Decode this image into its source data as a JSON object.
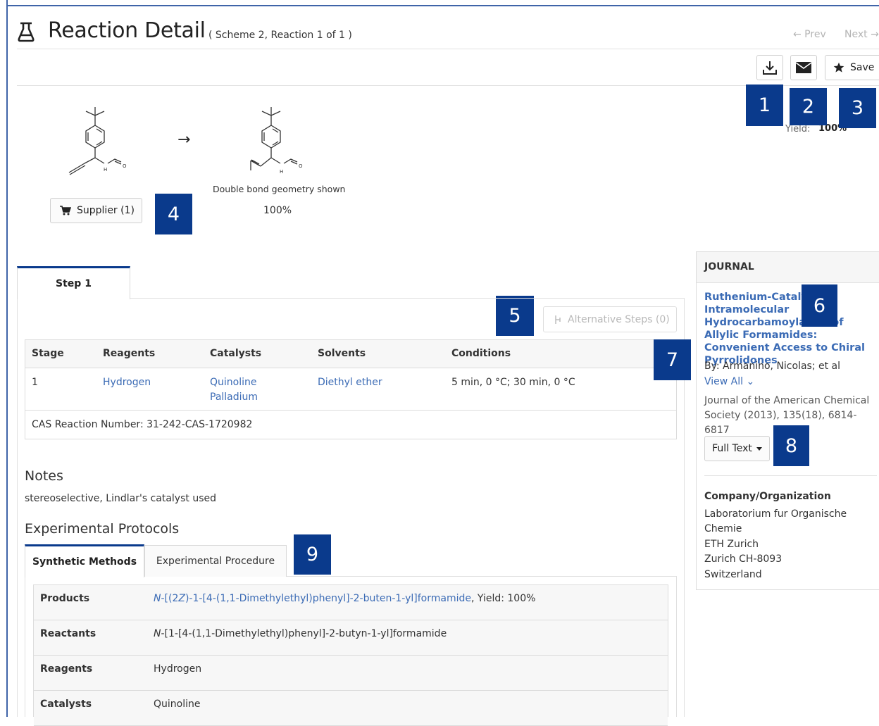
{
  "header": {
    "title": "Reaction Detail",
    "subtitle": "( Scheme 2, Reaction 1 of 1 )",
    "prev_label": "← Prev",
    "next_label": "Next →",
    "save_label": "Save"
  },
  "reaction": {
    "arrow": "→",
    "double_bond_note": "Double bond geometry shown",
    "product_yield": "100%",
    "supplier_label": "Supplier (1)",
    "yield_label": "Yield:",
    "yield_value": "100%"
  },
  "badges": [
    "1",
    "2",
    "3",
    "4",
    "5",
    "6",
    "7",
    "8",
    "9"
  ],
  "steps": {
    "tab_label": "Step 1",
    "alt_steps_label": "Alternative Steps (0)"
  },
  "reaction_table": {
    "headers": [
      "Stage",
      "Reagents",
      "Catalysts",
      "Solvents",
      "Conditions"
    ],
    "row": {
      "stage": "1",
      "reagents": "Hydrogen",
      "catalyst_1": "Quinoline",
      "catalyst_2": "Palladium",
      "solvents": "Diethyl ether",
      "conditions": "5 min, 0 °C; 30 min, 0 °C"
    },
    "cas_number": "CAS Reaction Number: 31-242-CAS-1720982"
  },
  "notes": {
    "heading": "Notes",
    "text": "stereoselective, Lindlar's catalyst used"
  },
  "protocols": {
    "heading": "Experimental Protocols",
    "tab_synthetic": "Synthetic Methods",
    "tab_procedure": "Experimental Procedure",
    "rows": [
      {
        "label": "Products",
        "prefix": "N",
        "value": "-[(2",
        "z": "Z",
        "rest": ")-1-[4-(1,1-Dimethylethyl)phenyl]-2-buten-1-yl]formamide",
        "suffix": ", Yield: 100%"
      },
      {
        "label": "Reactants",
        "prefix": "N",
        "value": "-[1-[4-(1,1-Dimethylethyl)phenyl]-2-butyn-1-yl]formamide"
      },
      {
        "label": "Reagents",
        "value": "Hydrogen"
      },
      {
        "label": "Catalysts",
        "value": "Quinoline"
      }
    ]
  },
  "journal": {
    "heading": "JOURNAL",
    "title": "Ruthenium-Catalyzed Intramolecular Hydrocarbamoylation of Allylic Formamides: Convenient Access to Chiral Pyrrolidones",
    "authors": "By: Armanino, Nicolas; et al",
    "view_all": "View All ⌄",
    "source": "Journal of the American Chemical Society (2013), 135(18), 6814-6817",
    "full_text_label": "Full Text",
    "org_heading": "Company/Organization",
    "org_lines": [
      "Laboratorium fur Organische",
      "Chemie",
      "ETH Zurich",
      "Zurich CH-8093",
      "Switzerland"
    ]
  },
  "colors": {
    "accent": "#0a3a8c",
    "link": "#3b6bb5",
    "frame": "#3f64a8"
  }
}
